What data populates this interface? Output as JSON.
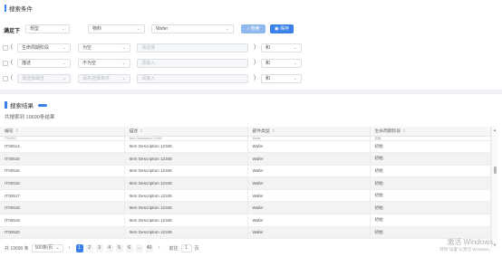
{
  "search_panel": {
    "title": "搜索条件",
    "label": "满足下",
    "top_filters": [
      {
        "value": "规型",
        "disabled": false
      },
      {
        "value": "物料",
        "disabled": false
      },
      {
        "value": "Wafer",
        "disabled": false
      }
    ],
    "search_button": "搜索",
    "save_button": "保存",
    "rows": [
      {
        "paren_open": "(",
        "field": "生命周期阶段",
        "field_disabled": false,
        "op": "为空",
        "op_disabled": false,
        "value": "请选择",
        "value_disabled": true,
        "paren_close": ")",
        "logic": "和"
      },
      {
        "paren_open": "(",
        "field": "描述",
        "field_disabled": false,
        "op": "不为空",
        "op_disabled": false,
        "value": "请输入",
        "value_disabled": true,
        "paren_close": ")",
        "logic": "和"
      },
      {
        "paren_open": "(",
        "field": "请选择属性",
        "field_disabled": true,
        "op": "请先选择条件",
        "op_disabled": true,
        "value": "请输入",
        "value_disabled": true,
        "paren_close": ")",
        "logic": "和"
      }
    ]
  },
  "results_panel": {
    "title": "搜索结果",
    "count_text": "共搜索到 19690条结果",
    "columns": [
      "编号",
      "描述",
      "部件类型",
      "生命周期阶段"
    ],
    "partial_row": {
      "id": "IT00513",
      "desc": "Item Description 12345",
      "type": "Wafer",
      "stage": "初始"
    },
    "rows": [
      {
        "id": "IT00514",
        "desc": "Item Description 12345",
        "type": "Wafer",
        "stage": "初始"
      },
      {
        "id": "IT00515",
        "desc": "Item Description 12345",
        "type": "Wafer",
        "stage": "初始"
      },
      {
        "id": "IT00516",
        "desc": "Item Description 12345",
        "type": "Wafer",
        "stage": "初始"
      },
      {
        "id": "IT00516",
        "desc": "Item Description 12345",
        "type": "Wafer",
        "stage": "初始"
      },
      {
        "id": "IT00517",
        "desc": "Item Description 12345",
        "type": "Wafer",
        "stage": "初始"
      },
      {
        "id": "IT00518",
        "desc": "Item Description 12345",
        "type": "Wafer",
        "stage": "初始"
      },
      {
        "id": "IT00519",
        "desc": "Item Description 12345",
        "type": "Wafer",
        "stage": "初始"
      },
      {
        "id": "IT00520",
        "desc": "Item Description 12345",
        "type": "Wafer",
        "stage": "初始"
      }
    ]
  },
  "pagination": {
    "total": "共 19690 条",
    "page_size": "500条/页",
    "prev": "‹",
    "next": "›",
    "pages": [
      "1",
      "2",
      "3",
      "4",
      "5",
      "6",
      "…",
      "40"
    ],
    "active_page": "1",
    "goto_label": "前往",
    "goto_value": "1",
    "page_suffix": "页"
  },
  "watermark": {
    "line1": "激活 Windows",
    "line2": "转到\"设置\"以激活 Windows。"
  },
  "colors": {
    "accent": "#3b7fe8",
    "accent_light": "#8fb8ef"
  }
}
